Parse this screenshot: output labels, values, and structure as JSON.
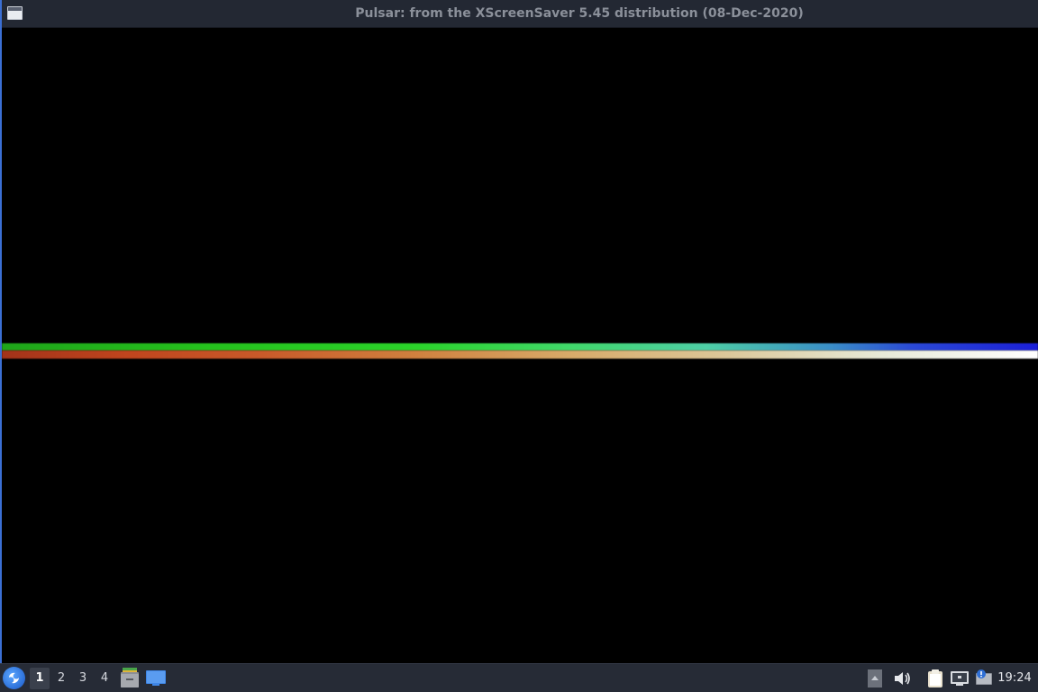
{
  "window": {
    "title": "Pulsar: from the XScreenSaver 5.45 distribution (08-Dec-2020)"
  },
  "taskbar": {
    "workspaces": [
      "1",
      "2",
      "3",
      "4"
    ],
    "active_workspace": "1",
    "clock": "19:24",
    "icons": {
      "start": "lxqt-start-icon",
      "files": "file-manager-icon",
      "desktop": "show-desktop-icon",
      "tray_up": "tray-expand-icon",
      "volume": "volume-icon",
      "clipboard": "clipboard-icon",
      "network": "network-icon",
      "updates": "update-notifier-icon"
    }
  },
  "colors": {
    "titlebar": "#232833",
    "title_text": "#8b909a",
    "taskbar": "#262b36",
    "window_border": "#3b6fd4",
    "beam_green": "#2bd42a",
    "beam_red": "#c0451e",
    "beam_blue": "#1b1fd8"
  }
}
